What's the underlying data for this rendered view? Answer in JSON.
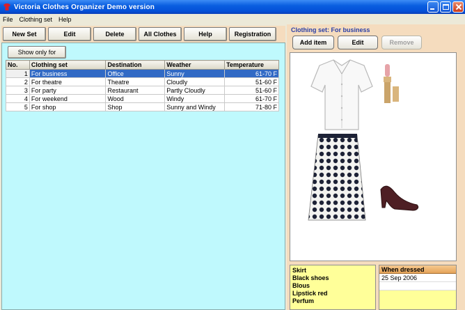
{
  "window": {
    "title": "Victoria Clothes Organizer Demo version"
  },
  "menu": [
    "File",
    "Clothing set",
    "Help"
  ],
  "toolbar": {
    "new_set": "New Set",
    "edit": "Edit",
    "delete": "Delete",
    "all_clothes": "All Clothes",
    "help": "Help",
    "registration": "Registration"
  },
  "filter": {
    "show_only_label": "Show only for"
  },
  "table": {
    "columns": [
      "No.",
      "Clothing set",
      "Destination",
      "Weather",
      "Temperature"
    ],
    "rows": [
      {
        "no": "1",
        "set": "For business",
        "destination": "Office",
        "weather": "Sunny",
        "temperature": "61-70 F"
      },
      {
        "no": "2",
        "set": "For theatre",
        "destination": "Theatre",
        "weather": "Cloudly",
        "temperature": "51-60 F"
      },
      {
        "no": "3",
        "set": "For party",
        "destination": "Restaurant",
        "weather": "Partly Cloudly",
        "temperature": "51-60 F"
      },
      {
        "no": "4",
        "set": "For weekend",
        "destination": "Wood",
        "weather": "Windy",
        "temperature": "61-70 F"
      },
      {
        "no": "5",
        "set": "For shop",
        "destination": "Shop",
        "weather": "Sunny and Windy",
        "temperature": "71-80 F"
      }
    ]
  },
  "detail": {
    "title": "Clothing set: For business",
    "add_item": "Add item",
    "edit": "Edit",
    "remove": "Remove",
    "items": [
      "Skirt",
      "Black shoes",
      "Blous",
      "Lipstick red",
      "Perfum"
    ],
    "when_dressed_header": "When dressed",
    "dates": [
      "25 Sep 2006"
    ]
  },
  "colors": {
    "titlebar": "#0a5fe0",
    "left_panel_bg": "#bff9fd",
    "right_panel_bg": "#f5dcbe",
    "selection": "#316ac5",
    "items_bg": "#ffff99"
  }
}
